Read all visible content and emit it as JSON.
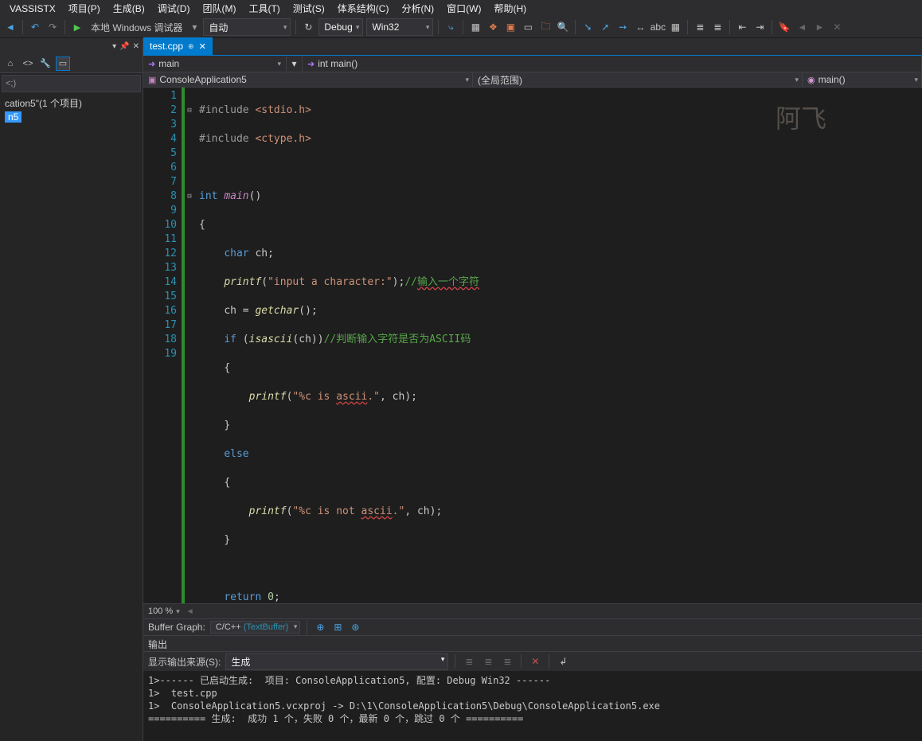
{
  "menu": [
    "VASSISTX",
    "项目(P)",
    "生成(B)",
    "调试(D)",
    "团队(M)",
    "工具(T)",
    "测试(S)",
    "体系结构(C)",
    "分析(N)",
    "窗口(W)",
    "帮助(H)"
  ],
  "toolbar": {
    "debugger_label": "本地 Windows 调试器",
    "mode": "自动",
    "config": "Debug",
    "platform": "Win32"
  },
  "left": {
    "search_placeholder": "<;)",
    "solution_label": "cation5\"(1 个项目)",
    "project_label": "n5"
  },
  "tab": {
    "name": "test.cpp"
  },
  "nav": {
    "scope": "main",
    "func": "int main()"
  },
  "context": {
    "project": "ConsoleApplication5",
    "scope": "(全局范围)",
    "member": "main()"
  },
  "zoom": "100 %",
  "buffer": {
    "label": "Buffer Graph:",
    "value": "C/C++",
    "sub": "(TextBuffer)"
  },
  "output": {
    "title": "输出",
    "source_label": "显示输出来源(S):",
    "source_value": "生成",
    "lines": [
      "1>------ 已启动生成:  项目: ConsoleApplication5, 配置: Debug Win32 ------",
      "1>  test.cpp",
      "1>  ConsoleApplication5.vcxproj -> D:\\1\\ConsoleApplication5\\Debug\\ConsoleApplication5.exe",
      "========== 生成:  成功 1 个，失败 0 个，最新 0 个，跳过 0 个 =========="
    ]
  },
  "watermark": "阿飞",
  "code": {
    "line_count": 19
  }
}
